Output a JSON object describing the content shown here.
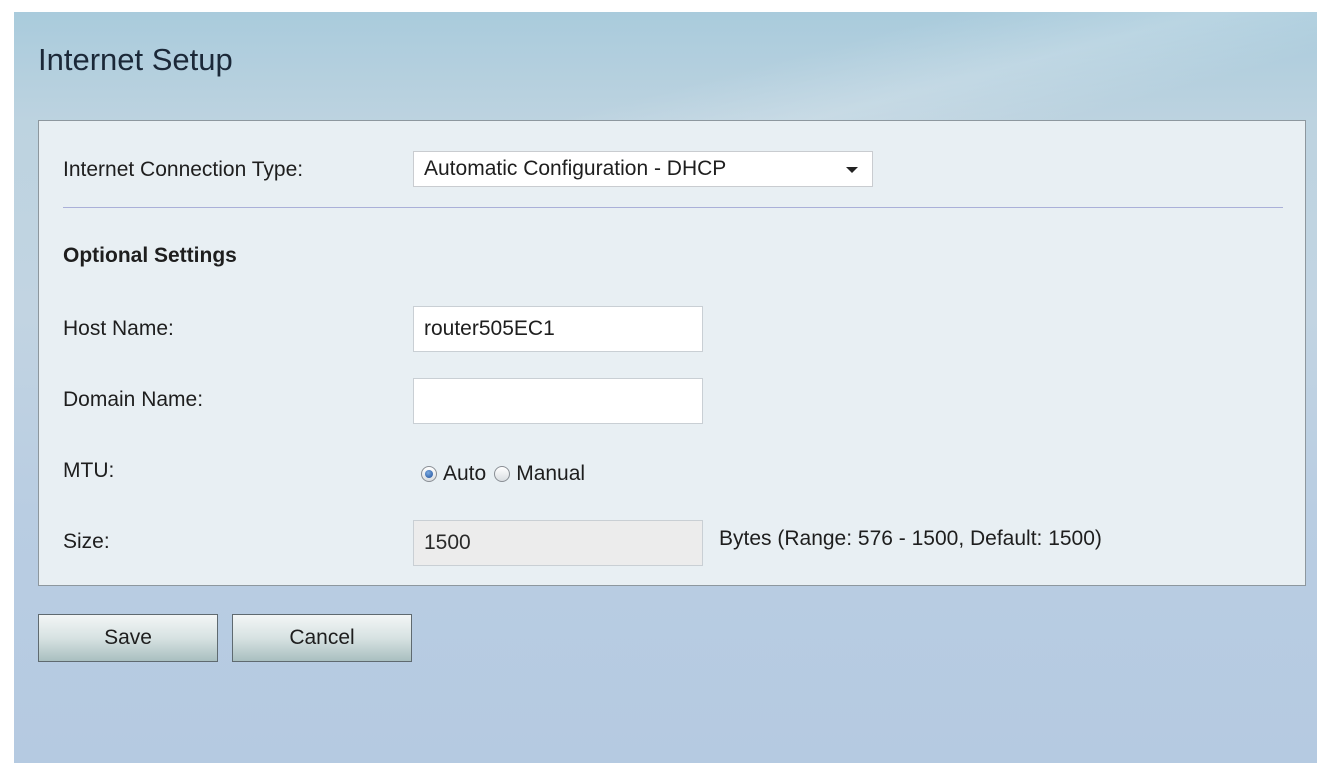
{
  "page": {
    "title": "Internet Setup"
  },
  "connection": {
    "label": "Internet Connection Type:",
    "selected": "Automatic Configuration - DHCP"
  },
  "optional": {
    "title": "Optional Settings",
    "host_name": {
      "label": "Host Name:",
      "value": "router505EC1"
    },
    "domain_name": {
      "label": "Domain Name:",
      "value": ""
    },
    "mtu": {
      "label": "MTU:",
      "options": [
        "Auto",
        "Manual"
      ],
      "selected": "Auto"
    },
    "size": {
      "label": "Size:",
      "value": "1500",
      "hint": "Bytes (Range: 576 - 1500, Default: 1500)"
    }
  },
  "actions": {
    "save_label": "Save",
    "cancel_label": "Cancel"
  },
  "colors": {
    "panel_bg": "#e8eff3",
    "page_bg": "#bdd3e0",
    "divider": "#aab0d8",
    "radio_checked": "#1e4f9a"
  }
}
